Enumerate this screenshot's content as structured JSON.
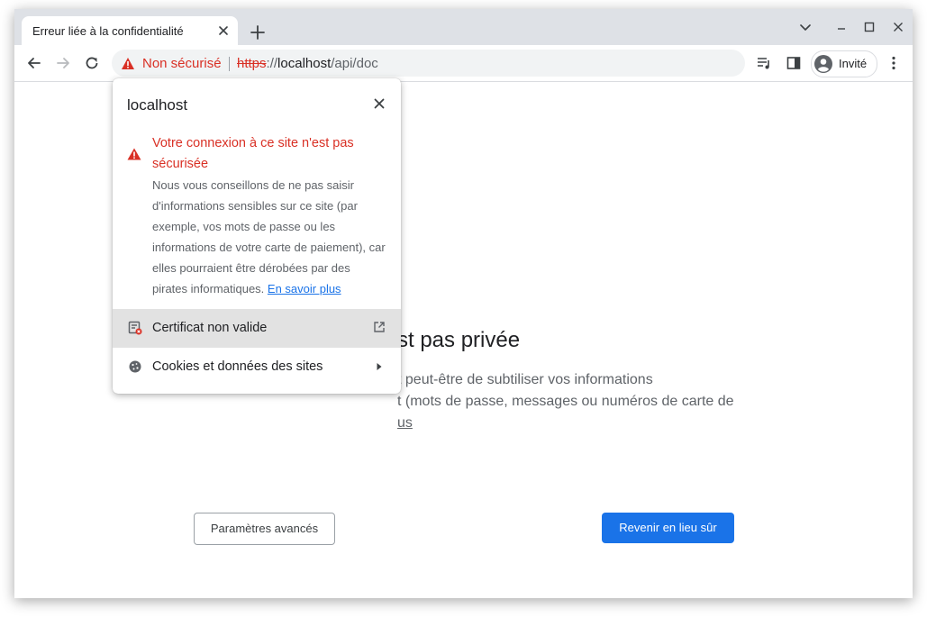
{
  "tab": {
    "title": "Erreur liée à la confidentialité"
  },
  "omnibox": {
    "status": "Non sécurisé",
    "scheme": "https",
    "separator": "://",
    "host": "localhost",
    "path": "/api/doc"
  },
  "profile": {
    "label": "Invité"
  },
  "colors": {
    "danger": "#d93025",
    "link": "#1a73e8",
    "primary_button": "#1a73e8",
    "tabstrip": "#dee1e6"
  },
  "popup": {
    "host": "localhost",
    "warning_title": "Votre connexion à ce site n'est pas sécurisée",
    "warning_body": "Nous vous conseillons de ne pas saisir d'informations sensibles sur ce site (par exemple, vos mots de passe ou les informations de votre carte de paiement), car elles pourraient être dérobées par des pirates informatiques.",
    "learn_more": "En savoir plus",
    "certificate_label": "Certificat non valide",
    "cookies_label": "Cookies et données des sites"
  },
  "page": {
    "heading_visible": "st pas privée",
    "paragraph_line1": "t peut-être de subtiliser vos informations",
    "paragraph_line2": "t (mots de passe, messages ou numéros de carte de",
    "paragraph_line3": "us",
    "advanced_button": "Paramètres avancés",
    "back_button": "Revenir en lieu sûr"
  },
  "icons": {
    "tab_close": "close-icon",
    "new_tab": "plus-icon",
    "tab_search": "chevron-down-icon",
    "minimize": "minimize-icon",
    "maximize": "maximize-icon",
    "close_window": "close-icon",
    "back": "arrow-left-icon",
    "forward": "arrow-right-icon",
    "reload": "reload-icon",
    "security_warning": "warning-triangle-icon",
    "media_controls": "media-queue-icon",
    "side_panel": "side-panel-icon",
    "avatar": "guest-avatar-icon",
    "menu": "kebab-menu-icon",
    "certificate": "certificate-invalid-icon",
    "external": "external-link-icon",
    "cookies": "cookie-icon",
    "submenu_arrow": "triangle-right-icon"
  }
}
